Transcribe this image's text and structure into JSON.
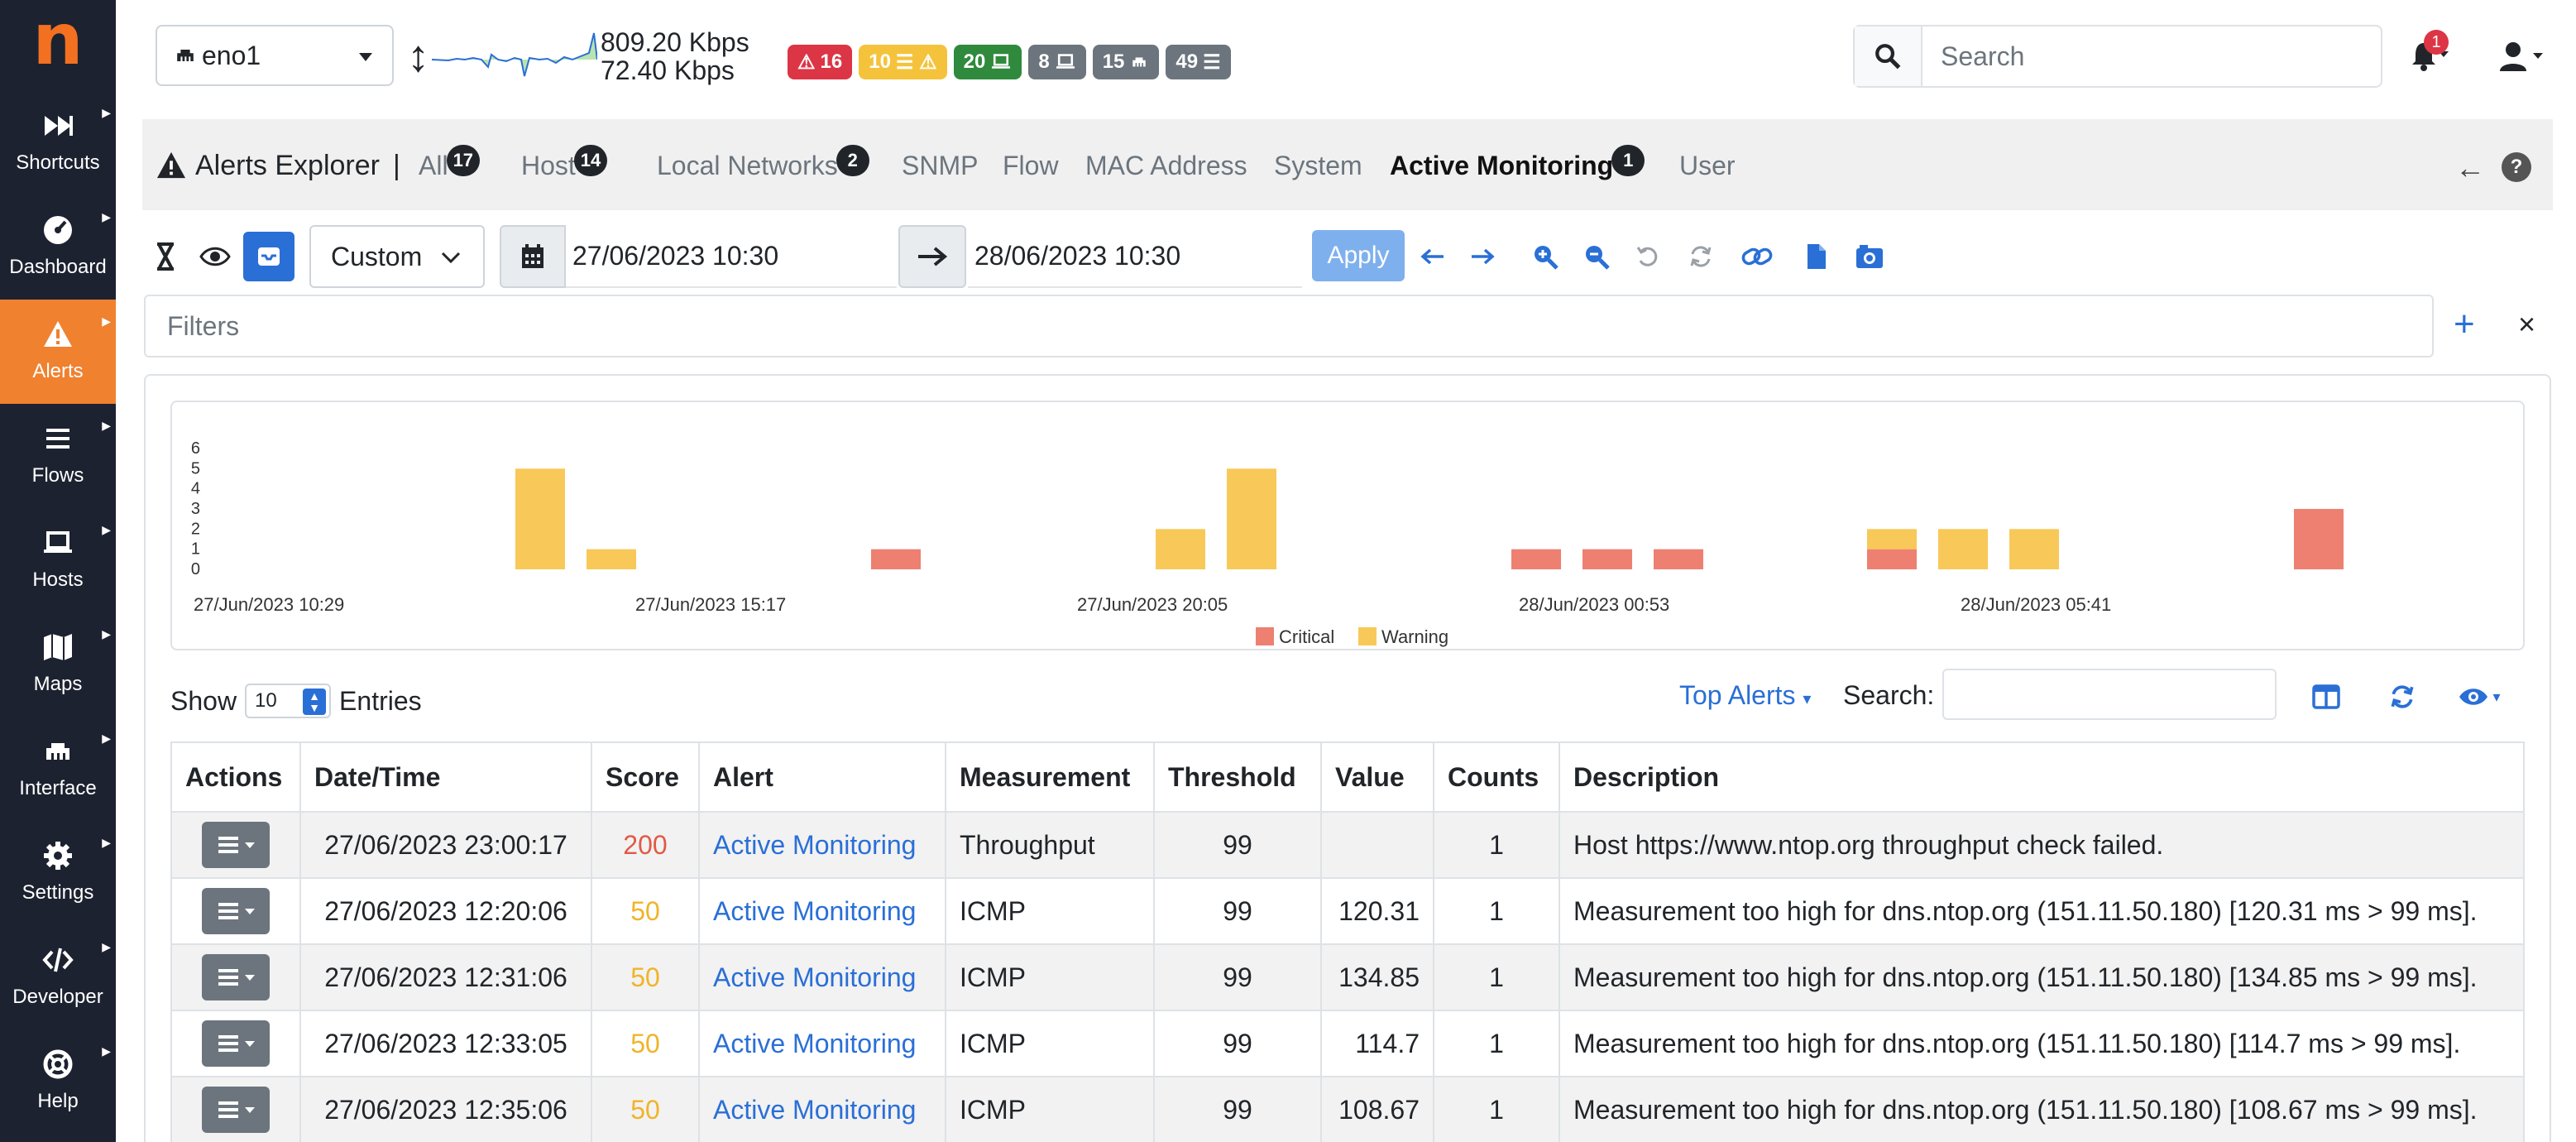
{
  "app": {
    "logo": "n"
  },
  "sidebar": {
    "items": [
      {
        "label": "Shortcuts",
        "icon": "fast-forward-icon"
      },
      {
        "label": "Dashboard",
        "icon": "gauge-icon"
      },
      {
        "label": "Alerts",
        "icon": "warning-icon",
        "active": true
      },
      {
        "label": "Flows",
        "icon": "bars-icon"
      },
      {
        "label": "Hosts",
        "icon": "laptop-icon"
      },
      {
        "label": "Maps",
        "icon": "map-icon"
      },
      {
        "label": "Interface",
        "icon": "ethernet-icon"
      },
      {
        "label": "Settings",
        "icon": "gear-icon"
      },
      {
        "label": "Developer",
        "icon": "code-icon"
      },
      {
        "label": "Help",
        "icon": "lifebuoy-icon"
      }
    ]
  },
  "topbar": {
    "interface": "eno1",
    "rate_up": "809.20 Kbps",
    "rate_down": "72.40 Kbps",
    "badges": [
      {
        "text": "16",
        "color": "#dc3545",
        "icon": "warning-icon"
      },
      {
        "text": "10",
        "color": "#f5c33b",
        "icon": "list-warning-icon"
      },
      {
        "text": "20",
        "color": "#2f8a3d",
        "icon": "laptop-icon"
      },
      {
        "text": "8",
        "color": "#6c757d",
        "icon": "laptop-icon"
      },
      {
        "text": "15",
        "color": "#6c757d",
        "icon": "ethernet-icon"
      },
      {
        "text": "49",
        "color": "#6c757d",
        "icon": "list-icon"
      }
    ],
    "search_placeholder": "Search",
    "notifications": "1"
  },
  "tabs": {
    "title": "Alerts Explorer",
    "separator": "|",
    "items": [
      {
        "label": "All",
        "count": "17"
      },
      {
        "label": "Host",
        "count": "14"
      },
      {
        "label": "Local Networks",
        "count": "2"
      },
      {
        "label": "SNMP",
        "count": ""
      },
      {
        "label": "Flow",
        "count": ""
      },
      {
        "label": "MAC Address",
        "count": ""
      },
      {
        "label": "System",
        "count": ""
      },
      {
        "label": "Active Monitoring",
        "count": "1",
        "active": true
      },
      {
        "label": "User",
        "count": ""
      }
    ]
  },
  "toolbar": {
    "preset": "Custom",
    "date_from": "27/06/2023 10:30",
    "date_to": "28/06/2023 10:30",
    "apply": "Apply"
  },
  "filters": {
    "placeholder": "Filters"
  },
  "chart_data": {
    "type": "bar",
    "stacked": true,
    "x_labels": [
      "27/Jun/2023 10:29",
      "27/Jun/2023 15:17",
      "27/Jun/2023 20:05",
      "28/Jun/2023 00:53",
      "28/Jun/2023 05:41"
    ],
    "y_ticks": [
      "6",
      "5",
      "4",
      "3",
      "2",
      "1",
      "0"
    ],
    "ylim": [
      0,
      6
    ],
    "series": [
      {
        "name": "Critical",
        "color": "#ee8071",
        "values": [
          0,
          0,
          0,
          0,
          0,
          0,
          0,
          0,
          1,
          0,
          0,
          0,
          0,
          0,
          0,
          0,
          0,
          1,
          1,
          1,
          0,
          0,
          1,
          0,
          0,
          0,
          0,
          0,
          3,
          0,
          0,
          0,
          0
        ]
      },
      {
        "name": "Warning",
        "color": "#f8c859",
        "values": [
          0,
          0,
          0,
          5,
          1,
          0,
          0,
          0,
          0,
          0,
          0,
          0,
          2,
          5,
          0,
          0,
          0,
          0,
          0,
          0,
          0,
          0,
          1,
          2,
          2,
          0,
          0,
          0,
          0,
          0,
          0,
          0,
          0
        ]
      }
    ],
    "legend_position": "bottom"
  },
  "table": {
    "show_label": "Show",
    "page_size": "10",
    "entries_label": "Entries",
    "top_alerts": "Top Alerts",
    "search_label": "Search:",
    "columns": [
      "Actions",
      "Date/Time",
      "Score",
      "Alert",
      "Measurement",
      "Threshold",
      "Value",
      "Counts",
      "Description"
    ],
    "rows": [
      {
        "datetime": "27/06/2023 23:00:17",
        "score": "200",
        "score_color": "#e05a47",
        "alert": "Active Monitoring",
        "measurement": "Throughput",
        "threshold": "99",
        "value": "",
        "counts": "1",
        "description": "Host https://www.ntop.org throughput check failed."
      },
      {
        "datetime": "27/06/2023 12:20:06",
        "score": "50",
        "score_color": "#f0b429",
        "alert": "Active Monitoring",
        "measurement": "ICMP",
        "threshold": "99",
        "value": "120.31",
        "counts": "1",
        "description": "Measurement too high for dns.ntop.org (151.11.50.180) [120.31 ms > 99 ms]."
      },
      {
        "datetime": "27/06/2023 12:31:06",
        "score": "50",
        "score_color": "#f0b429",
        "alert": "Active Monitoring",
        "measurement": "ICMP",
        "threshold": "99",
        "value": "134.85",
        "counts": "1",
        "description": "Measurement too high for dns.ntop.org (151.11.50.180) [134.85 ms > 99 ms]."
      },
      {
        "datetime": "27/06/2023 12:33:05",
        "score": "50",
        "score_color": "#f0b429",
        "alert": "Active Monitoring",
        "measurement": "ICMP",
        "threshold": "99",
        "value": "114.7",
        "counts": "1",
        "description": "Measurement too high for dns.ntop.org (151.11.50.180) [114.7 ms > 99 ms]."
      },
      {
        "datetime": "27/06/2023 12:35:06",
        "score": "50",
        "score_color": "#f0b429",
        "alert": "Active Monitoring",
        "measurement": "ICMP",
        "threshold": "99",
        "value": "108.67",
        "counts": "1",
        "description": "Measurement too high for dns.ntop.org (151.11.50.180) [108.67 ms > 99 ms]."
      }
    ]
  }
}
